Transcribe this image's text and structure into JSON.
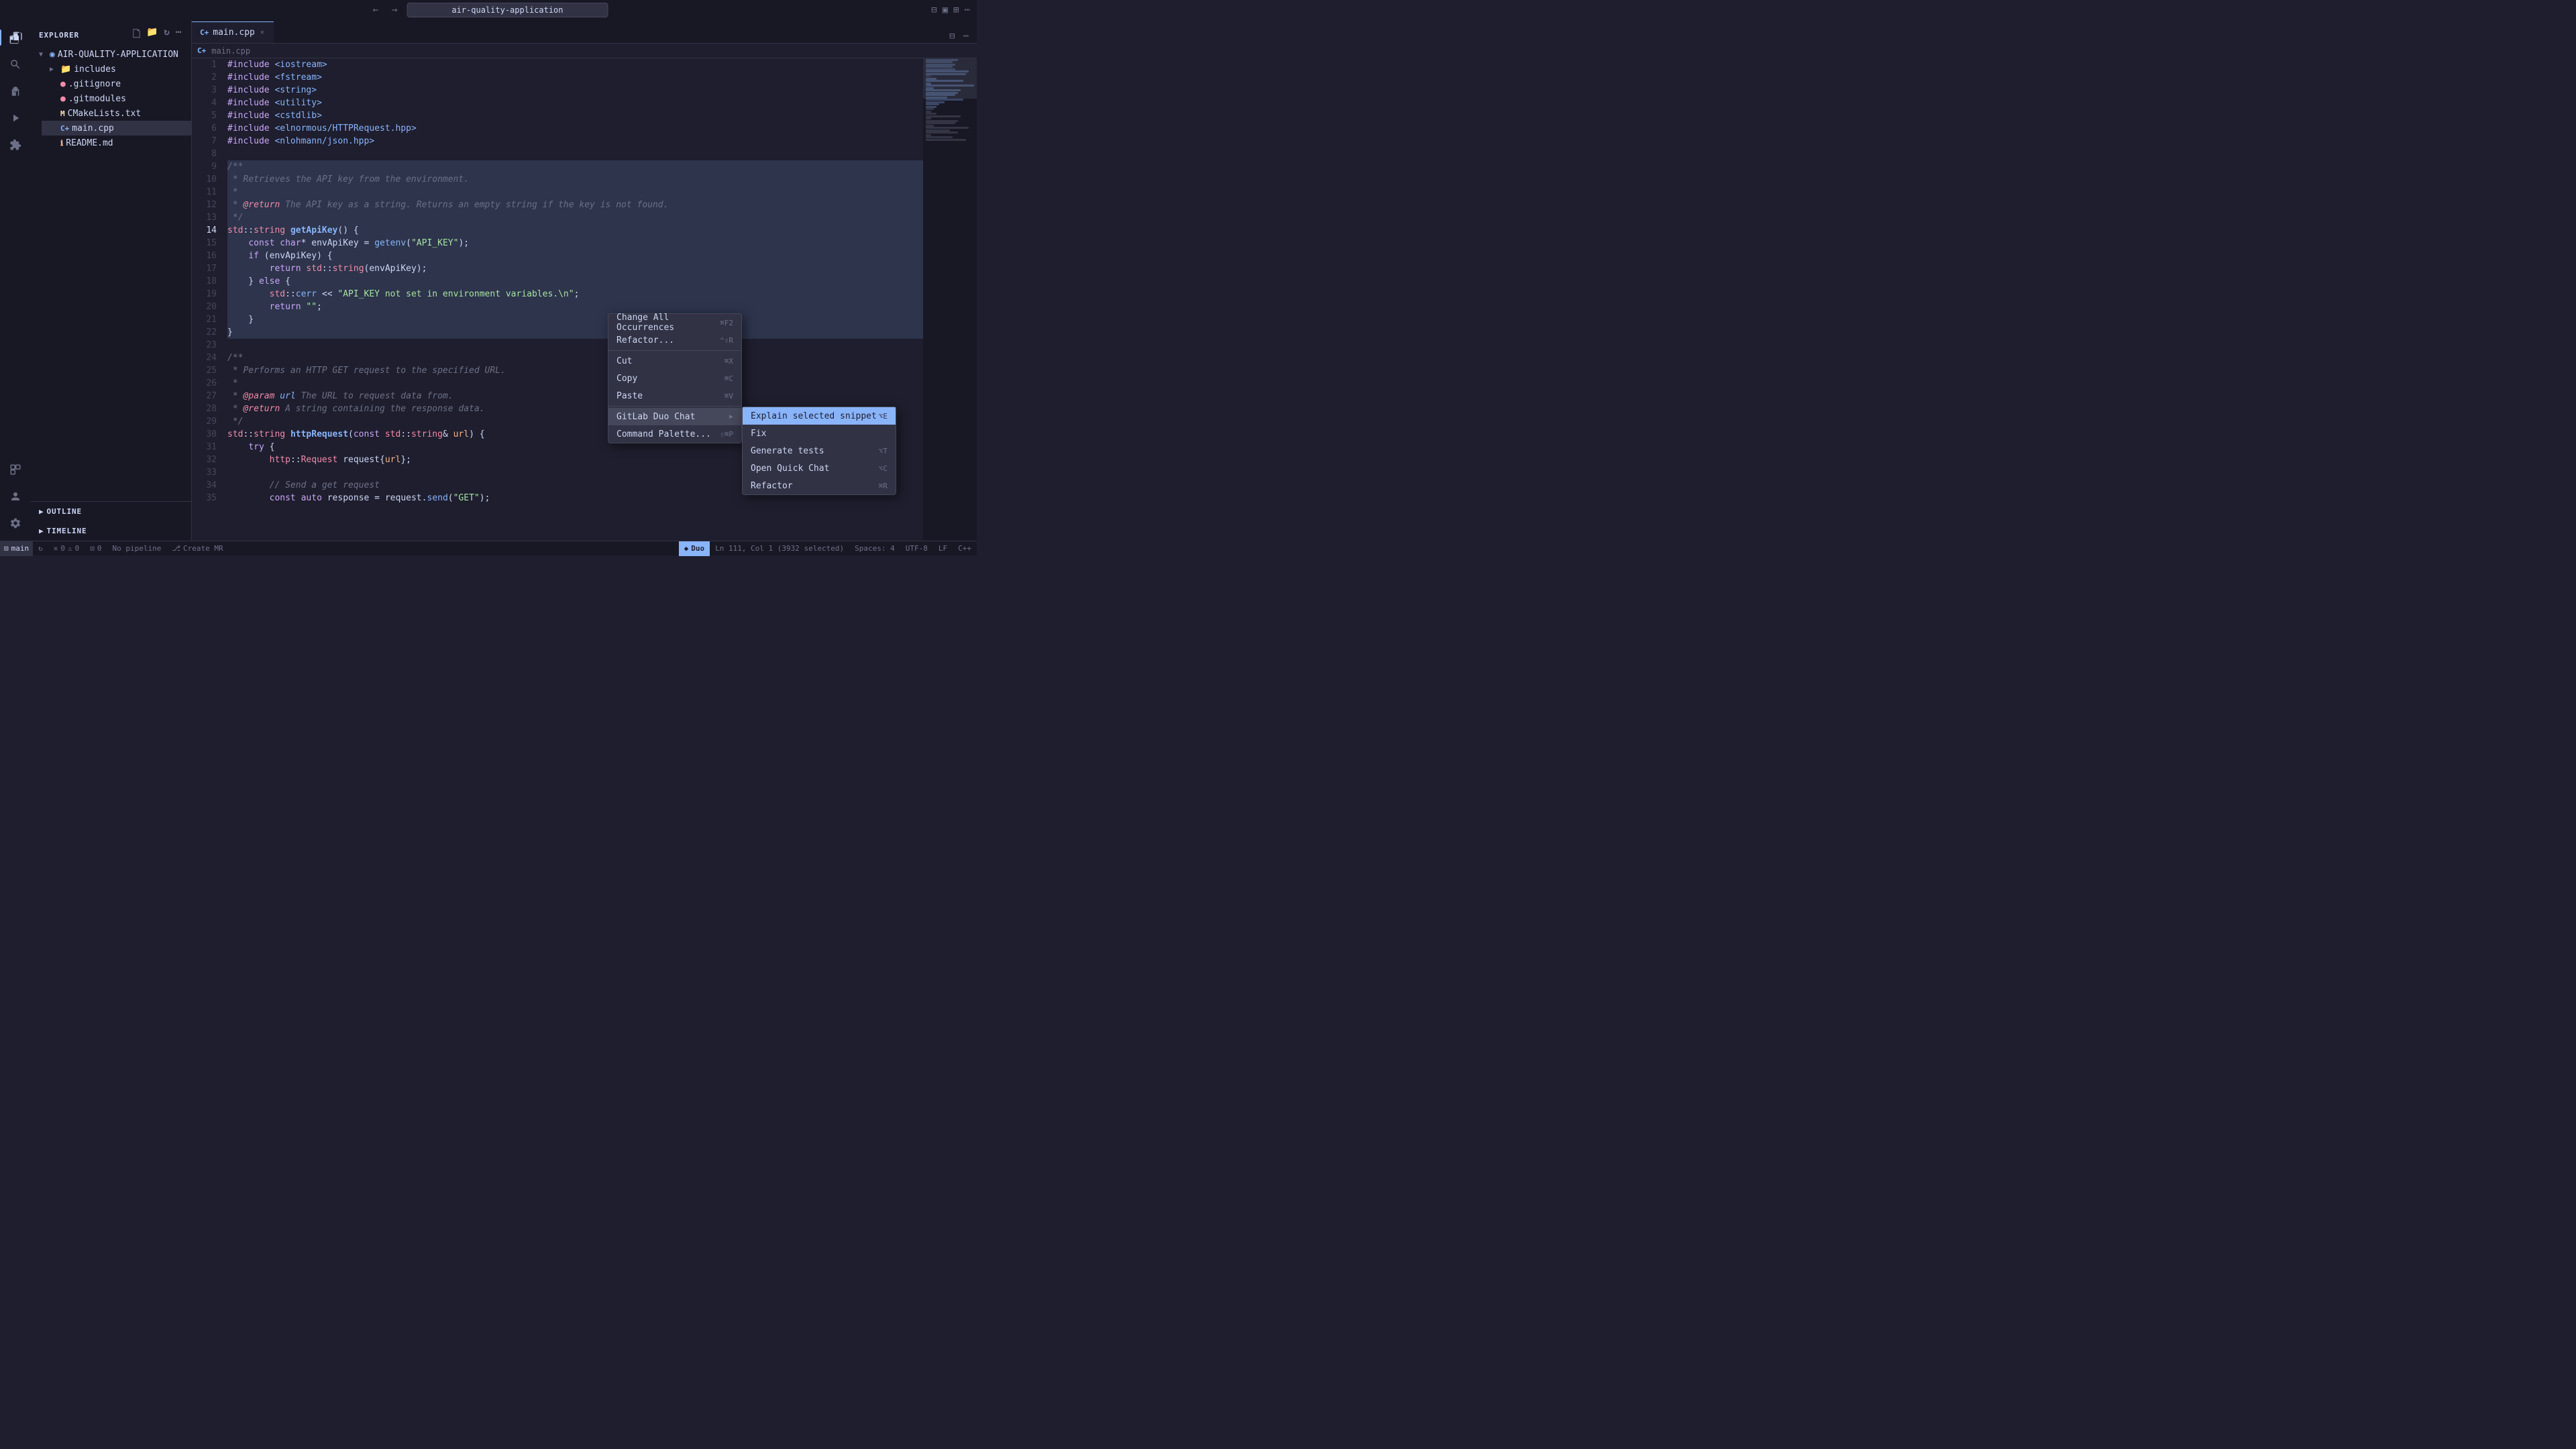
{
  "titlebar": {
    "search_placeholder": "air-quality-application",
    "back_label": "←",
    "forward_label": "→"
  },
  "activity_bar": {
    "items": [
      {
        "name": "explorer",
        "icon": "⬜",
        "active": true
      },
      {
        "name": "search",
        "icon": "🔍"
      },
      {
        "name": "source-control",
        "icon": "⑂"
      },
      {
        "name": "run",
        "icon": "▷"
      },
      {
        "name": "extensions",
        "icon": "⧉"
      }
    ],
    "bottom_items": [
      {
        "name": "remote",
        "icon": "⊡"
      },
      {
        "name": "account",
        "icon": "○"
      },
      {
        "name": "settings",
        "icon": "⚙"
      }
    ]
  },
  "sidebar": {
    "title": "EXPLORER",
    "project": {
      "name": "AIR-QUALITY-APPLICATION",
      "items": [
        {
          "type": "folder",
          "name": "includes",
          "expanded": false
        },
        {
          "type": "file",
          "name": ".gitignore",
          "icon_type": "gitignore"
        },
        {
          "type": "file",
          "name": ".gitmodules",
          "icon_type": "gitmodules"
        },
        {
          "type": "file",
          "name": "CMakeLists.txt",
          "icon_type": "cmake"
        },
        {
          "type": "file",
          "name": "main.cpp",
          "icon_type": "cpp",
          "active": true
        },
        {
          "type": "file",
          "name": "README.md",
          "icon_type": "readme"
        }
      ]
    },
    "sections": [
      {
        "name": "OUTLINE"
      },
      {
        "name": "TIMELINE"
      }
    ]
  },
  "editor": {
    "tab": {
      "filename": "main.cpp",
      "icon": "C+",
      "dirty": false
    },
    "breadcrumb": {
      "filename": "main.cpp"
    },
    "lines": [
      {
        "num": 1,
        "content": "#include <iostream>",
        "selected": false
      },
      {
        "num": 2,
        "content": "#include <fstream>",
        "selected": false
      },
      {
        "num": 3,
        "content": "#include <string>",
        "selected": false
      },
      {
        "num": 4,
        "content": "#include <utility>",
        "selected": false
      },
      {
        "num": 5,
        "content": "#include <cstdlib>",
        "selected": false
      },
      {
        "num": 6,
        "content": "#include <elnormous/HTTPRequest.hpp>",
        "selected": false
      },
      {
        "num": 7,
        "content": "#include <nlohmann/json.hpp>",
        "selected": false
      },
      {
        "num": 8,
        "content": "",
        "selected": false
      },
      {
        "num": 9,
        "content": "/**",
        "selected": true
      },
      {
        "num": 10,
        "content": " * Retrieves the API key from the environment.",
        "selected": true
      },
      {
        "num": 11,
        "content": " *",
        "selected": true
      },
      {
        "num": 12,
        "content": " * @return The API key as a string. Returns an empty string if the key is not found.",
        "selected": true
      },
      {
        "num": 13,
        "content": " */",
        "selected": true
      },
      {
        "num": 14,
        "content": "std::string getApiKey() {",
        "selected": true
      },
      {
        "num": 15,
        "content": "    const char* envApiKey = getenv(\"API_KEY\");",
        "selected": true
      },
      {
        "num": 16,
        "content": "    if (envApiKey) {",
        "selected": true
      },
      {
        "num": 17,
        "content": "        return std::string(envApiKey);",
        "selected": true
      },
      {
        "num": 18,
        "content": "    } else {",
        "selected": true
      },
      {
        "num": 19,
        "content": "        std::cerr << \"API_KEY not set in environment variables.\\n\";",
        "selected": true
      },
      {
        "num": 20,
        "content": "        return \"\";",
        "selected": true
      },
      {
        "num": 21,
        "content": "    }",
        "selected": true
      },
      {
        "num": 22,
        "content": "}",
        "selected": true
      },
      {
        "num": 23,
        "content": "",
        "selected": false
      },
      {
        "num": 24,
        "content": "/**",
        "selected": false
      },
      {
        "num": 25,
        "content": " * Performs an HTTP GET request to the specified URL.",
        "selected": false
      },
      {
        "num": 26,
        "content": " *",
        "selected": false
      },
      {
        "num": 27,
        "content": " * @param url The URL to request data from.",
        "selected": false
      },
      {
        "num": 28,
        "content": " * @return A string containing the response data.",
        "selected": false
      },
      {
        "num": 29,
        "content": " */",
        "selected": false
      },
      {
        "num": 30,
        "content": "std::string httpRequest(const std::string& url) {",
        "selected": false
      },
      {
        "num": 31,
        "content": "    try {",
        "selected": false
      },
      {
        "num": 32,
        "content": "        http::Request request{url};",
        "selected": false
      },
      {
        "num": 33,
        "content": "",
        "selected": false
      },
      {
        "num": 34,
        "content": "        // Send a get request",
        "selected": false
      },
      {
        "num": 35,
        "content": "        const auto response = request.send(\"GET\");",
        "selected": false
      }
    ]
  },
  "context_menu": {
    "items": [
      {
        "label": "Change All Occurrences",
        "shortcut": "⌘F2",
        "type": "item"
      },
      {
        "label": "Refactor...",
        "shortcut": "⌃⇧R",
        "type": "item"
      },
      {
        "type": "separator"
      },
      {
        "label": "Cut",
        "shortcut": "⌘X",
        "type": "item"
      },
      {
        "label": "Copy",
        "shortcut": "⌘C",
        "type": "item"
      },
      {
        "label": "Paste",
        "shortcut": "⌘V",
        "type": "item"
      },
      {
        "type": "separator"
      },
      {
        "label": "GitLab Duo Chat",
        "shortcut": "",
        "type": "submenu"
      },
      {
        "label": "Command Palette...",
        "shortcut": "⇧⌘P",
        "type": "item"
      }
    ],
    "submenu": {
      "items": [
        {
          "label": "Explain selected snippet",
          "shortcut": "⌥E",
          "highlighted": true
        },
        {
          "label": "Fix",
          "shortcut": ""
        },
        {
          "label": "Generate tests",
          "shortcut": "⌥T"
        },
        {
          "label": "Open Quick Chat",
          "shortcut": "⌥C"
        },
        {
          "label": "Refactor",
          "shortcut": "⌘R"
        }
      ]
    }
  },
  "status_bar": {
    "branch": "main",
    "sync_icon": "↻",
    "errors": "0",
    "warnings": "0",
    "remote_icon": "⊡",
    "remote_count": "0",
    "pipeline": "No pipeline",
    "create_mr": "Create MR",
    "position": "Ln 111, Col 1 (3932 selected)",
    "spaces": "Spaces: 4",
    "encoding": "UTF-8",
    "line_ending": "LF",
    "language": "C++",
    "duo": "Duo"
  }
}
